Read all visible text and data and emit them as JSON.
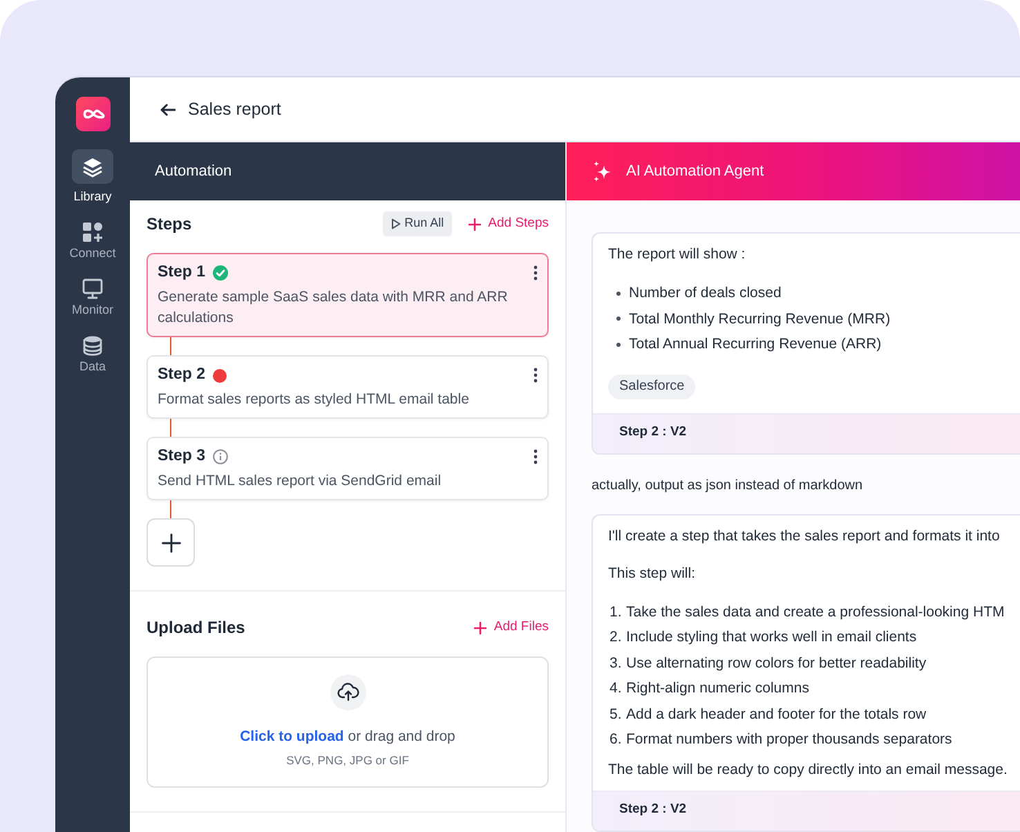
{
  "sidebar": {
    "items": [
      {
        "label": "Library",
        "selected": true
      },
      {
        "label": "Connect",
        "selected": false
      },
      {
        "label": "Monitor",
        "selected": false
      },
      {
        "label": "Data",
        "selected": false
      }
    ]
  },
  "header": {
    "title": "Sales report"
  },
  "automation": {
    "title": "Automation",
    "steps_title": "Steps",
    "run_all": "Run All",
    "add_steps": "Add Steps",
    "steps": [
      {
        "title": "Step 1",
        "kind": "success",
        "description": "Generate sample SaaS sales data with MRR and ARR calculations",
        "selected": true
      },
      {
        "title": "Step 2",
        "kind": "error",
        "description": "Format sales reports as styled HTML email table",
        "selected": false
      },
      {
        "title": "Step 3",
        "kind": "info",
        "description": "Send HTML sales report via SendGrid email",
        "selected": false
      }
    ],
    "upload": {
      "title": "Upload Files",
      "add_files": "Add Files",
      "link": "Click to upload",
      "text": "or drag and drop",
      "hint": "SVG, PNG, JPG or GIF"
    }
  },
  "agent": {
    "title": "AI Automation Agent",
    "messages": [
      {
        "kind": "agent",
        "blocks": [
          {
            "kind": "text",
            "text": "The report will show :"
          },
          {
            "kind": "bullets",
            "items": [
              "Number of deals closed",
              "Total Monthly Recurring Revenue (MRR)",
              "Total Annual Recurring Revenue (ARR)"
            ]
          },
          {
            "kind": "tag",
            "text": "Salesforce"
          }
        ],
        "footer": "Step 2 : V2"
      },
      {
        "kind": "user",
        "text": "actually, output as json instead of markdown"
      },
      {
        "kind": "agent",
        "blocks": [
          {
            "kind": "text",
            "text": "I'll create a step that takes the sales report and formats it into"
          },
          {
            "kind": "text",
            "text": "This step will:"
          },
          {
            "kind": "numbered",
            "items": [
              {
                "number": "1.",
                "text": "Take the sales data and create a professional-looking HTM"
              },
              {
                "number": "2.",
                "text": "Include styling that works well in email clients"
              },
              {
                "number": "3.",
                "text": "Use alternating row colors for better readability"
              },
              {
                "number": "4.",
                "text": "Right-align numeric columns"
              },
              {
                "number": "5.",
                "text": "Add a dark header and footer for the totals row"
              },
              {
                "number": "6.",
                "text": "Format numbers with proper thousands separators"
              }
            ]
          },
          {
            "kind": "text",
            "text": "The table will be ready to copy directly into an email message."
          }
        ],
        "footer": "Step 2 : V2"
      }
    ]
  }
}
